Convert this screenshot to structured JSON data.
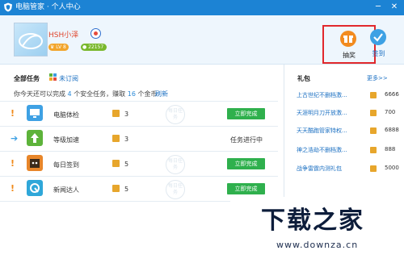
{
  "window": {
    "title": "电脑管家 · 个人中心",
    "minimize": "─",
    "close": "✕"
  },
  "profile": {
    "username": "HSH小泽",
    "level": "LV 8",
    "coins": "22157"
  },
  "actions": {
    "lottery_label": "抽奖",
    "signin_label": "签到"
  },
  "tasks": {
    "heading": "全部任务",
    "unsubscribed": "未订阅",
    "info_prefix": "你今天还可以完成",
    "info_count": "4",
    "info_middle": "个安全任务，赚取",
    "info_coins": "16",
    "info_suffix": "个金币",
    "refresh": "刷新",
    "stamp": "每日任务",
    "rows": [
      {
        "mark": "!",
        "name": "电脑体检",
        "reward": "3",
        "action": "立即完成",
        "status": ""
      },
      {
        "mark": "➔",
        "name": "等级加速",
        "reward": "3",
        "action": "",
        "status": "任务进行中"
      },
      {
        "mark": "!",
        "name": "每日签到",
        "reward": "5",
        "action": "立即完成",
        "status": ""
      },
      {
        "mark": "!",
        "name": "新闻达人",
        "reward": "5",
        "action": "立即完成",
        "status": ""
      }
    ]
  },
  "gifts": {
    "title": "礼包",
    "more": "更多>>",
    "items": [
      {
        "name": "上古世纪不删档激...",
        "value": "6666"
      },
      {
        "name": "天涯明月刀开放激...",
        "value": "700"
      },
      {
        "name": "天天酷跑管家特权...",
        "value": "6888"
      },
      {
        "name": "神之浩劫不删档激...",
        "value": "888"
      },
      {
        "name": "战争雷霆内测礼包",
        "value": "5000"
      }
    ]
  },
  "watermark": {
    "brand": "下载之家",
    "url": "www.downza.cn"
  },
  "colors": {
    "titlebar": "#1c83d4",
    "accent_green": "#2fb04d",
    "highlight_red": "#e1282c",
    "coin_gold": "#e7a62c"
  }
}
